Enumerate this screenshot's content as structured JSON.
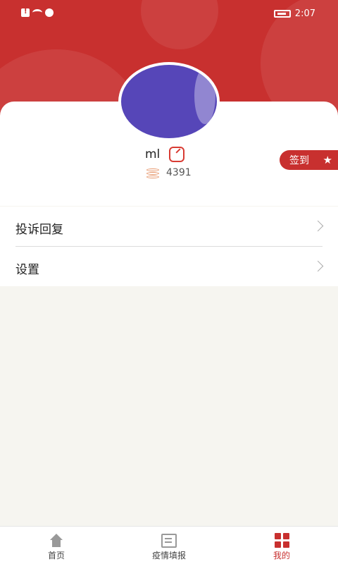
{
  "status_bar": {
    "time": "2:07"
  },
  "profile": {
    "username": "ml",
    "points": "4391"
  },
  "signin": {
    "label": "签到"
  },
  "menu": {
    "items": [
      {
        "label": "投诉回复"
      },
      {
        "label": "设置"
      }
    ]
  },
  "tabbar": {
    "items": [
      {
        "label": "首页",
        "icon": "home-icon",
        "active": false
      },
      {
        "label": "疫情填报",
        "icon": "form-edit-icon",
        "active": false
      },
      {
        "label": "我的",
        "icon": "grid-icon",
        "active": true
      }
    ]
  },
  "colors": {
    "accent": "#c8302f",
    "background": "#f6f5f0"
  }
}
